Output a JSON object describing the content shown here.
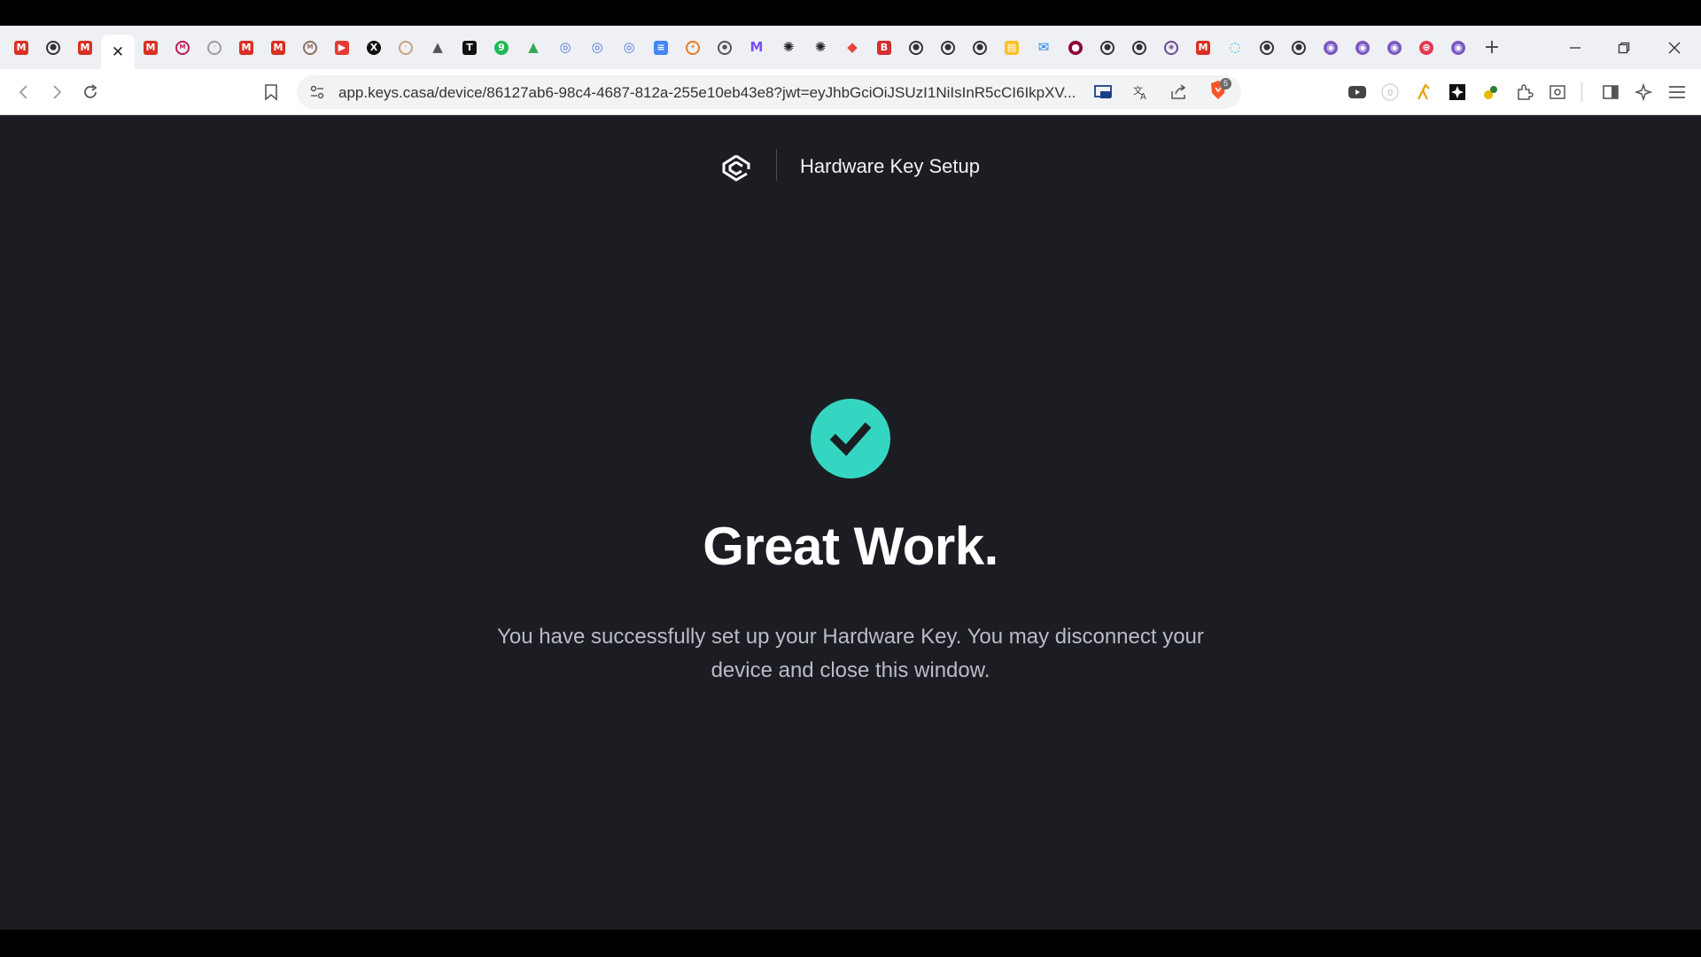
{
  "browser": {
    "tabs": [
      {
        "icon": "gmail-icon",
        "glyph": "M",
        "color": "#d93025",
        "shape": "sq"
      },
      {
        "icon": "github-icon",
        "glyph": "⬤",
        "color": "#333333",
        "shape": "ring"
      },
      {
        "icon": "gmail-icon",
        "glyph": "M",
        "color": "#d93025",
        "shape": "sq"
      },
      {
        "icon": "close-icon",
        "glyph": "✕",
        "color": "#222222",
        "shape": "active"
      },
      {
        "icon": "gmail-icon",
        "glyph": "M",
        "color": "#d93025",
        "shape": "sq"
      },
      {
        "icon": "grayed-mail-icon",
        "glyph": "M",
        "color": "#c2185b",
        "shape": "ring"
      },
      {
        "icon": "loading-icon",
        "glyph": "·",
        "color": "#9e9e9e",
        "shape": "ring"
      },
      {
        "icon": "gmail-icon",
        "glyph": "M",
        "color": "#d93025",
        "shape": "sq"
      },
      {
        "icon": "gmail-icon",
        "glyph": "M",
        "color": "#d93025",
        "shape": "sq"
      },
      {
        "icon": "grayed-mail-icon",
        "glyph": "M",
        "color": "#8d6e63",
        "shape": "ring"
      },
      {
        "icon": "youtube-icon",
        "glyph": "▶",
        "color": "#e53935",
        "shape": "sq"
      },
      {
        "icon": "x-icon",
        "glyph": "X",
        "color": "#111111",
        "shape": "round"
      },
      {
        "icon": "loading-icon",
        "glyph": "·",
        "color": "#c7a27c",
        "shape": "ring"
      },
      {
        "icon": "vercel-icon",
        "glyph": "▲",
        "color": "#555555",
        "shape": "plain"
      },
      {
        "icon": "tt-icon",
        "glyph": "T",
        "color": "#111111",
        "shape": "sq"
      },
      {
        "icon": "chat-icon",
        "glyph": "9",
        "color": "#1db954",
        "shape": "round"
      },
      {
        "icon": "drive-icon",
        "glyph": "▲",
        "color": "#34a853",
        "shape": "plain"
      },
      {
        "icon": "globe-icon",
        "glyph": "◎",
        "color": "#4a7bd0",
        "shape": "plain"
      },
      {
        "icon": "globe-icon",
        "glyph": "◎",
        "color": "#4a7bd0",
        "shape": "plain"
      },
      {
        "icon": "globe-icon",
        "glyph": "◎",
        "color": "#4a7bd0",
        "shape": "plain"
      },
      {
        "icon": "docs-icon",
        "glyph": "≡",
        "color": "#4285f4",
        "shape": "sq"
      },
      {
        "icon": "compass-icon",
        "glyph": "✦",
        "color": "#e67e22",
        "shape": "ring"
      },
      {
        "icon": "settings-icon",
        "glyph": "●",
        "color": "#555555",
        "shape": "ring"
      },
      {
        "icon": "mail-purple-icon",
        "glyph": "M",
        "color": "#7c4dff",
        "shape": "plain"
      },
      {
        "icon": "openai-icon",
        "glyph": "✺",
        "color": "#222222",
        "shape": "plain"
      },
      {
        "icon": "openai-icon",
        "glyph": "✺",
        "color": "#222222",
        "shape": "plain"
      },
      {
        "icon": "shapes-icon",
        "glyph": "◆",
        "color": "#e8453c",
        "shape": "plain"
      },
      {
        "icon": "b-icon",
        "glyph": "B",
        "color": "#d32f2f",
        "shape": "sq"
      },
      {
        "icon": "github-icon",
        "glyph": "⬤",
        "color": "#333333",
        "shape": "ring"
      },
      {
        "icon": "github-icon",
        "glyph": "⬤",
        "color": "#333333",
        "shape": "ring"
      },
      {
        "icon": "github-icon",
        "glyph": "⬤",
        "color": "#333333",
        "shape": "ring"
      },
      {
        "icon": "notes-icon",
        "glyph": "▤",
        "color": "#fbc02d",
        "shape": "sq"
      },
      {
        "icon": "chat-bubble-icon",
        "glyph": "✉",
        "color": "#1e88e5",
        "shape": "plain"
      },
      {
        "icon": "record-icon",
        "glyph": "●",
        "color": "#8e0038",
        "shape": "round"
      },
      {
        "icon": "github-icon",
        "glyph": "⬤",
        "color": "#333333",
        "shape": "ring"
      },
      {
        "icon": "github-icon",
        "glyph": "⬤",
        "color": "#333333",
        "shape": "ring"
      },
      {
        "icon": "target-icon",
        "glyph": "◉",
        "color": "#6d4c91",
        "shape": "ring"
      },
      {
        "icon": "gmail-icon",
        "glyph": "M",
        "color": "#d93025",
        "shape": "sq"
      },
      {
        "icon": "swirl-icon",
        "glyph": "◌",
        "color": "#26c6da",
        "shape": "plain"
      },
      {
        "icon": "github-icon",
        "glyph": "⬤",
        "color": "#333333",
        "shape": "ring"
      },
      {
        "icon": "github-icon",
        "glyph": "⬤",
        "color": "#333333",
        "shape": "ring"
      },
      {
        "icon": "orb-icon",
        "glyph": "◉",
        "color": "#7e57c2",
        "shape": "round"
      },
      {
        "icon": "orb-icon",
        "glyph": "◉",
        "color": "#7e57c2",
        "shape": "round"
      },
      {
        "icon": "orb-icon",
        "glyph": "◉",
        "color": "#7e57c2",
        "shape": "round"
      },
      {
        "icon": "lifebuoy-icon",
        "glyph": "⊕",
        "color": "#e53950",
        "shape": "round"
      },
      {
        "icon": "orb-icon",
        "glyph": "◉",
        "color": "#7e57c2",
        "shape": "round"
      }
    ],
    "new_tab_glyph": "+",
    "url": "app.keys.casa/device/86127ab6-98c4-4687-812a-255e10eb43e8?jwt=eyJhbGciOiJSUzI1NiIsInR5cCI6IkpXV...",
    "brave_badge": "5"
  },
  "page": {
    "header_title": "Hardware Key Setup",
    "headline": "Great Work.",
    "message": "You have successfully set up your Hardware Key. You may disconnect your device and close this window.",
    "accent_color": "#35d6c1",
    "background_color": "#1c1d22"
  }
}
